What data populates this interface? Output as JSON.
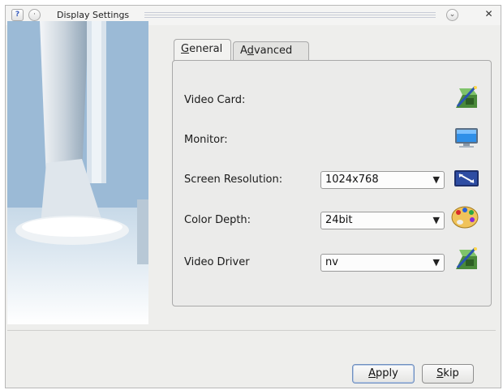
{
  "window": {
    "title": "Display Settings",
    "help_glyph": "?",
    "menu_glyph": "·",
    "minimize_glyph": "⌄",
    "close_glyph": "✕"
  },
  "tabs": [
    {
      "label_prefix": "",
      "label_mnemonic": "G",
      "label_rest": "eneral",
      "selected": true
    },
    {
      "label_prefix": "A",
      "label_mnemonic": "d",
      "label_rest": "vanced",
      "selected": false
    }
  ],
  "rows": {
    "video_card": {
      "label": "Video Card:",
      "icon": "graphics-card-wizard-icon"
    },
    "monitor": {
      "label": "Monitor:",
      "icon": "monitor-icon"
    },
    "resolution": {
      "label": "Screen Resolution:",
      "value": "1024x768",
      "icon": "display-resolution-icon"
    },
    "color_depth": {
      "label": "Color Depth:",
      "value": "24bit",
      "icon": "color-palette-icon"
    },
    "video_driver": {
      "label": "Video Driver",
      "value": "nv",
      "icon": "graphics-card-wizard-icon"
    }
  },
  "buttons": {
    "apply": {
      "mnemonic": "A",
      "rest": "pply"
    },
    "skip": {
      "mnemonic": "S",
      "rest": "kip"
    }
  },
  "colors": {
    "accent": "#6f8fbf",
    "window_bg": "#eeeeec"
  }
}
